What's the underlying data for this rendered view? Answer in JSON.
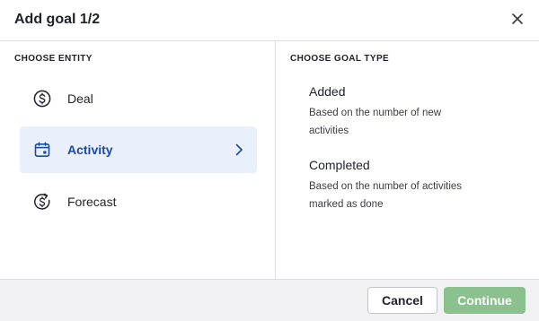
{
  "dialog": {
    "title": "Add goal 1/2",
    "close_icon": "close-icon"
  },
  "entity_section": {
    "title": "CHOOSE ENTITY",
    "items": [
      {
        "label": "Deal",
        "icon": "dollar-circle-icon",
        "selected": false
      },
      {
        "label": "Activity",
        "icon": "calendar-icon",
        "selected": true
      },
      {
        "label": "Forecast",
        "icon": "forecast-icon",
        "selected": false
      }
    ]
  },
  "goal_type_section": {
    "title": "CHOOSE GOAL TYPE",
    "items": [
      {
        "name": "Added",
        "description": "Based on the number of new activities"
      },
      {
        "name": "Completed",
        "description": "Based on the number of activities marked as done"
      }
    ]
  },
  "footer": {
    "cancel_label": "Cancel",
    "continue_label": "Continue"
  },
  "colors": {
    "selected_background": "#eaf0fb",
    "selected_text": "#1a4aa8",
    "continue_button": "#8bc18e",
    "footer_background": "#f2f2f4"
  }
}
